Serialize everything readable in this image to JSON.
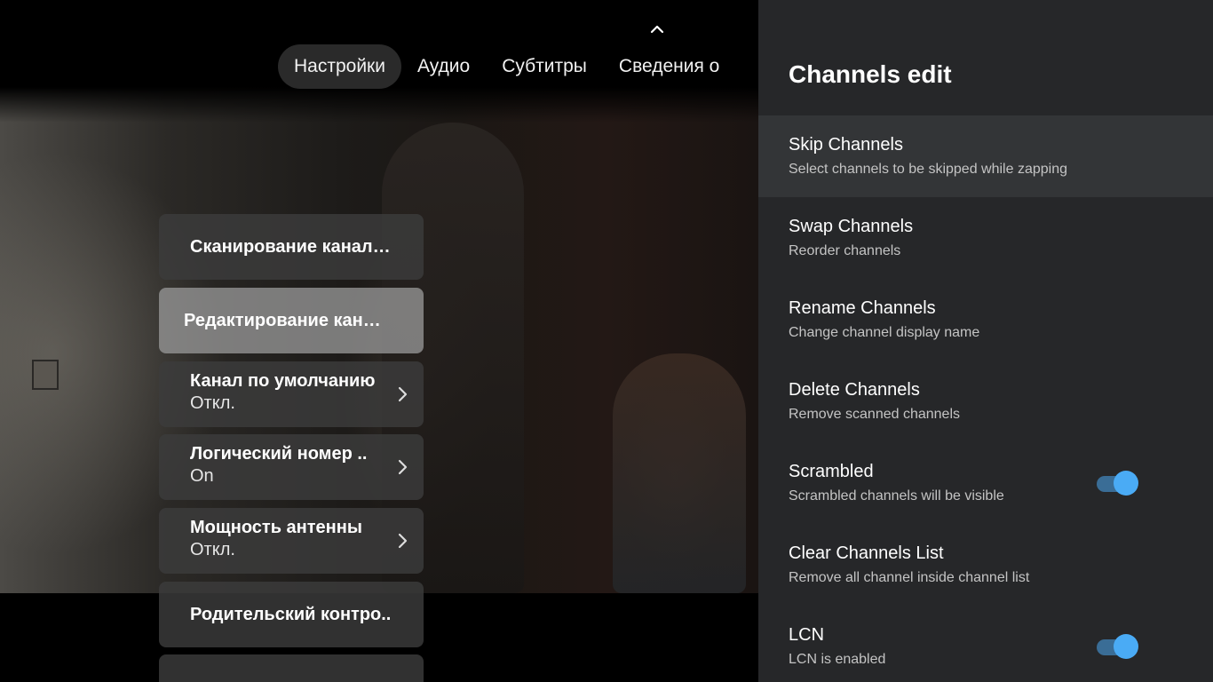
{
  "top_tabs": [
    {
      "label": "Настройки",
      "active": true
    },
    {
      "label": "Аудио",
      "active": false
    },
    {
      "label": "Субтитры",
      "active": false
    },
    {
      "label": "Сведения о",
      "active": false
    }
  ],
  "left_menu": [
    {
      "title": "Сканирование канал…",
      "sub": null
    },
    {
      "title": "Редактирование кан…",
      "sub": null,
      "focused": true
    },
    {
      "title": "Канал по умолчанию",
      "sub": "Откл.",
      "arrow": true
    },
    {
      "title": "Логический номер ..",
      "sub": "On",
      "arrow": true
    },
    {
      "title": "Мощность антенны",
      "sub": "Откл.",
      "arrow": true
    },
    {
      "title": "Родительский контро..",
      "sub": null
    }
  ],
  "panel": {
    "title": "Channels edit",
    "options": [
      {
        "title": "Skip Channels",
        "sub": "Select channels to be skipped while zapping",
        "focused": true
      },
      {
        "title": "Swap Channels",
        "sub": "Reorder channels"
      },
      {
        "title": "Rename Channels",
        "sub": "Change channel display name"
      },
      {
        "title": "Delete Channels",
        "sub": "Remove scanned channels"
      },
      {
        "title": "Scrambled",
        "sub": "Scrambled channels will be visible",
        "toggle": true
      },
      {
        "title": "Clear Channels List",
        "sub": "Remove all channel inside channel list"
      },
      {
        "title": "LCN",
        "sub": "LCN is enabled",
        "toggle": true
      }
    ]
  },
  "colors": {
    "panel_bg": "#262729",
    "toggle_on": "#4aabf5",
    "toggle_track": "#3a6d96"
  }
}
